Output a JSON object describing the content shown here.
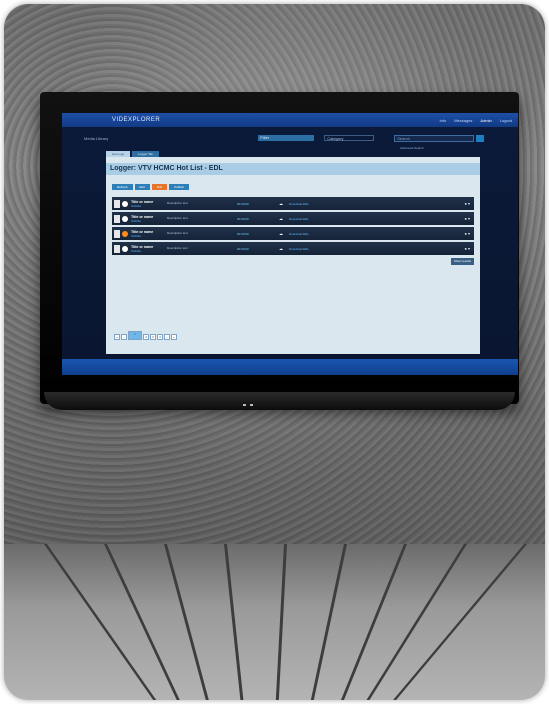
{
  "app": {
    "brand": "VIDEXPLORER",
    "top_items": [
      "Info",
      "Messages",
      "Logout"
    ],
    "user": "Admin"
  },
  "subbar": {
    "label": "Media Library",
    "filter1": "Filter",
    "filter2": "Category",
    "search_placeholder": "Search",
    "advanced": "Advanced Search"
  },
  "tabs": [
    "Hot Logs",
    "Logger Tab"
  ],
  "panel": {
    "title": "Logger: VTV HCMC Hot List - EDL"
  },
  "toolbar": [
    "Refresh",
    "Edit",
    "Sort",
    "Publish"
  ],
  "rows": [
    {
      "title": "Title or name",
      "sub": "Subtitle",
      "desc": "Description text",
      "time": "00:00:00",
      "cloud": "☁",
      "link": "Download EDL",
      "actions": "● ▾"
    },
    {
      "title": "Title or name",
      "sub": "Subtitle",
      "desc": "Description text",
      "time": "00:00:00",
      "cloud": "☁",
      "link": "Download EDL",
      "actions": "● ▾"
    },
    {
      "title": "Title or name",
      "sub": "Subtitle",
      "desc": "Description text",
      "time": "00:00:00",
      "cloud": "☁",
      "link": "Download EDL",
      "actions": "● ▾"
    },
    {
      "title": "Title or name",
      "sub": "Subtitle",
      "desc": "Description text",
      "time": "00:00:00",
      "cloud": "☁",
      "link": "Download EDL",
      "actions": "● ▾"
    }
  ],
  "more_button": "Show results",
  "pager": [
    "«",
    "‹",
    "1",
    "2",
    "3",
    "4",
    "›",
    "»"
  ],
  "colors": {
    "screen_bg": "#0b1a3a",
    "accent": "#2e7fb8",
    "active_tool": "#e3762b",
    "panel": "#dbe7ef"
  }
}
